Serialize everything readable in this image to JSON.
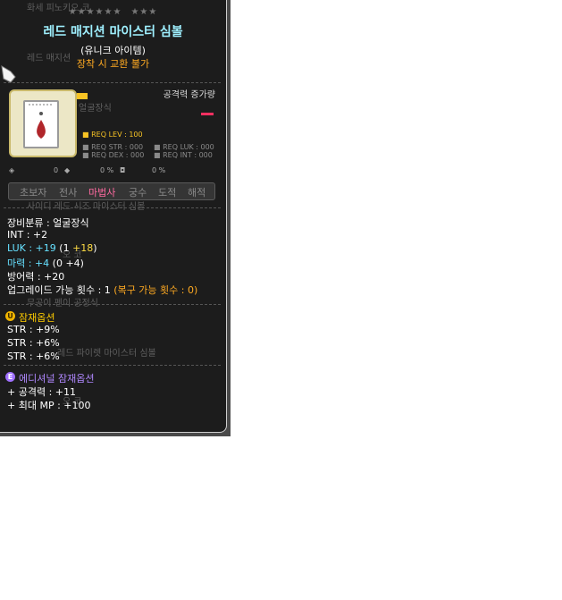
{
  "stars": {
    "left": "★★★★★★",
    "right": "★★★"
  },
  "item": {
    "name": "레드 매지션 마이스터 심볼",
    "rarity": "(유니크 아이템)",
    "trade": "장착 시 교환 불가",
    "attack_label": "공격력 증가량"
  },
  "requirements": {
    "lev": "REQ LEV : 100",
    "str": "REQ STR : 000",
    "luk": "REQ LUK : 000",
    "dex": "REQ DEX : 000",
    "int": "REQ INT : 000"
  },
  "icon_row": {
    "a": "0",
    "b": "0 %",
    "c": "0 %"
  },
  "jobs": [
    {
      "label": "초보자",
      "active": false
    },
    {
      "label": "전사",
      "active": false
    },
    {
      "label": "마법사",
      "active": true
    },
    {
      "label": "궁수",
      "active": false
    },
    {
      "label": "도적",
      "active": false
    },
    {
      "label": "해적",
      "active": false
    }
  ],
  "stats": {
    "category": "장비분류 : 얼굴장식",
    "int": "INT : +2",
    "luk_label": "LUK",
    "luk_total": " : +19 ",
    "luk_base_open": "(1 ",
    "luk_bonus": "+18",
    "luk_close": ")",
    "mag_label": "마력",
    "mag_total": " : +4 ",
    "mag_base": "(0 +4)",
    "def": "방어력 : +20",
    "upgrade": "업그레이드 가능 횟수 : 1 ",
    "upgrade_recover": "(복구 가능 횟수 : 0)"
  },
  "potential": {
    "badge": "U",
    "title": "잠재옵션",
    "lines": [
      "STR : +9%",
      "STR : +6%",
      "STR : +6%"
    ]
  },
  "additional": {
    "badge": "E",
    "title": "에디셔널 잠재옵션",
    "lines": [
      "+ 공격력 : +11",
      "+ 최대 MP : +100"
    ]
  },
  "background_text": [
    "화세 피노키오 코",
    "레드 매지션",
    "얼굴장식",
    "사이디 레드 시즈 마이스터 심볼",
    "오 코",
    "무공이 펜이 공정식",
    "레드 파이렛 마이스터 심볼",
    "오 코"
  ],
  "colors": {
    "title": "#9ff0ff",
    "trade": "#ffaa22",
    "active_job": "#ff6aa0",
    "potential": "#ffcc00",
    "additional": "#a070ff"
  }
}
